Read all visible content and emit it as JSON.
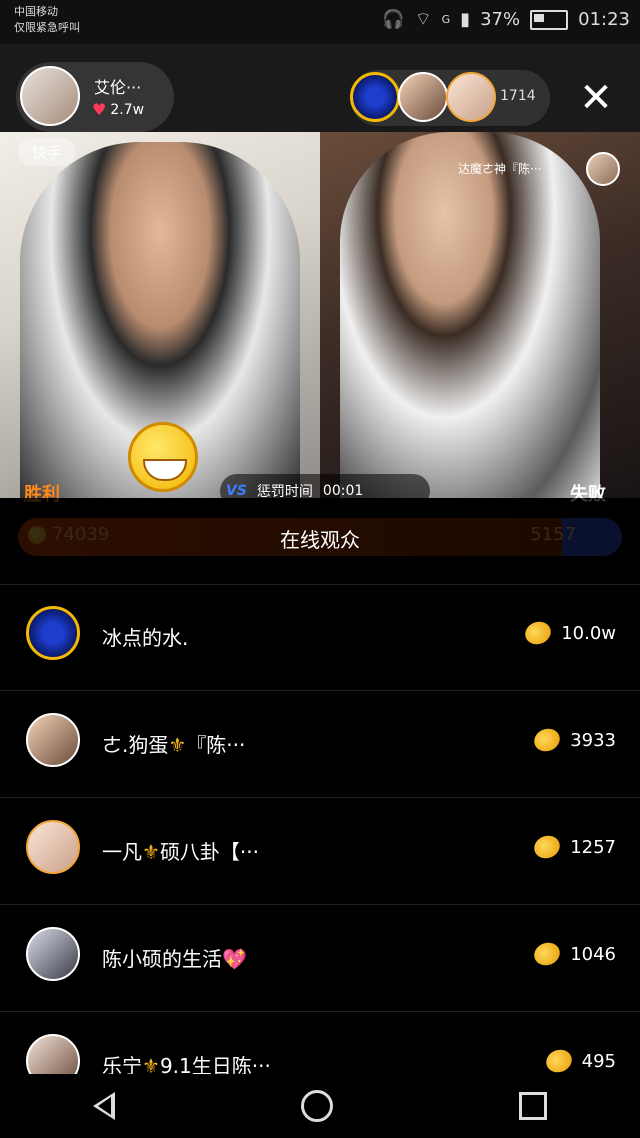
{
  "status_bar": {
    "carrier_line1": "中国移动",
    "carrier_line2": "仅限紧急呼叫",
    "network": "G",
    "battery": "37%",
    "time": "01:23"
  },
  "host": {
    "name": "艾伦···",
    "likes": "2.7w",
    "platform_badge": "快手"
  },
  "viewers": {
    "count": "1714"
  },
  "pk": {
    "left_result": "胜利",
    "right_result": "失败",
    "timer_label": "惩罚时间",
    "timer_value": "00:01",
    "left_score": "74039",
    "right_score": "5157",
    "right_streamer": "达魔ㄜ神『陈···",
    "victory_badge": "胜利"
  },
  "audience_sheet": {
    "title": "在线观众",
    "items": [
      {
        "name": "冰点的水.",
        "coins": "10.0w"
      },
      {
        "name": "ㄜ.狗蛋",
        "name_suffix": "『陈···",
        "coins": "3933",
        "has_fleur": true
      },
      {
        "name": "一凡",
        "name_suffix": "硕八卦【···",
        "coins": "1257",
        "has_fleur": true
      },
      {
        "name": "陈小硕的生活",
        "coins": "1046",
        "has_sparkle": true
      },
      {
        "name": "乐宁",
        "name_suffix": "9.1生日陈···",
        "coins": "495",
        "has_fleur": true
      }
    ]
  }
}
